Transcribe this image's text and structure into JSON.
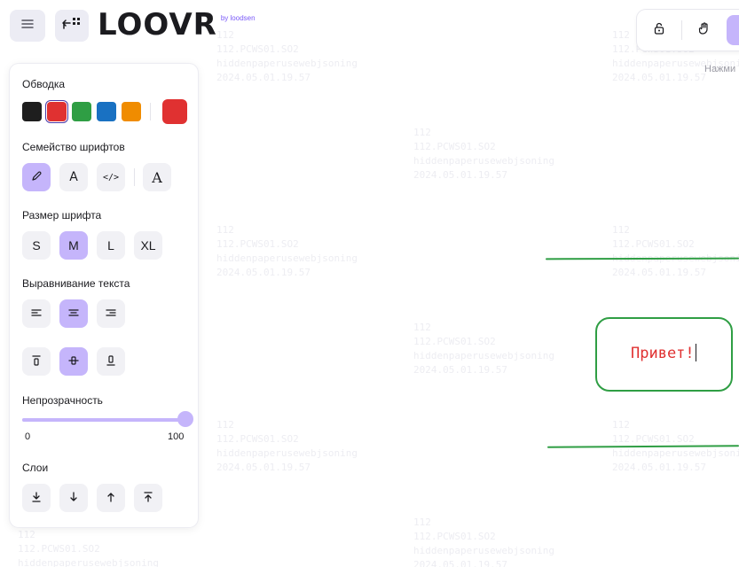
{
  "watermark": {
    "lines": [
      "112",
      "112.PCWS01.SO2",
      "hiddenpaperusewebjsoning",
      "2024.05.01.19.57"
    ]
  },
  "toolbar": {
    "menu_icon": "hamburger-menu-icon",
    "back_icon": "return-arrow-grid-icon",
    "logo_text": "LOOVR",
    "logo_byline": "by loodsen",
    "tools": [
      {
        "icon": "lock-open-icon"
      },
      {
        "icon": "hand-pan-icon"
      }
    ],
    "hint": "Нажми"
  },
  "panel": {
    "stroke": {
      "title": "Обводка",
      "colors": [
        "#1e1e1e",
        "#e03131",
        "#2f9e44",
        "#1971c2",
        "#f08c00"
      ],
      "selected_index": 1,
      "current": "#e03131"
    },
    "font_family": {
      "title": "Семейство шрифтов",
      "options": [
        {
          "icon": "pencil-handdrawn-icon",
          "glyph": "",
          "active": true
        },
        {
          "icon": "font-normal-icon",
          "glyph": "A",
          "active": false
        },
        {
          "icon": "code-font-icon",
          "glyph": "</>",
          "active": false
        },
        {
          "icon": "font-library-icon",
          "glyph": "A",
          "active": false
        }
      ]
    },
    "font_size": {
      "title": "Размер шрифта",
      "options": [
        "S",
        "M",
        "L",
        "XL"
      ],
      "selected": "M"
    },
    "text_align": {
      "title": "Выравнивание текста",
      "horizontal": [
        {
          "icon": "align-left-icon",
          "active": false
        },
        {
          "icon": "align-center-icon",
          "active": true
        },
        {
          "icon": "align-right-icon",
          "active": false
        }
      ],
      "vertical": [
        {
          "icon": "align-top-icon",
          "active": false
        },
        {
          "icon": "align-middle-icon",
          "active": true
        },
        {
          "icon": "align-bottom-icon",
          "active": false
        }
      ]
    },
    "opacity": {
      "title": "Непрозрачность",
      "value": 100,
      "min_label": "0",
      "max_label": "100"
    },
    "layers": {
      "title": "Слои",
      "options": [
        {
          "icon": "send-to-back-icon"
        },
        {
          "icon": "send-backward-icon"
        },
        {
          "icon": "bring-forward-icon"
        },
        {
          "icon": "bring-to-front-icon"
        }
      ]
    }
  },
  "canvas": {
    "text_element": {
      "text": "Привет!",
      "text_color": "#e03131",
      "border_color": "#2f9e44"
    },
    "line_color": "#2f9e44"
  }
}
